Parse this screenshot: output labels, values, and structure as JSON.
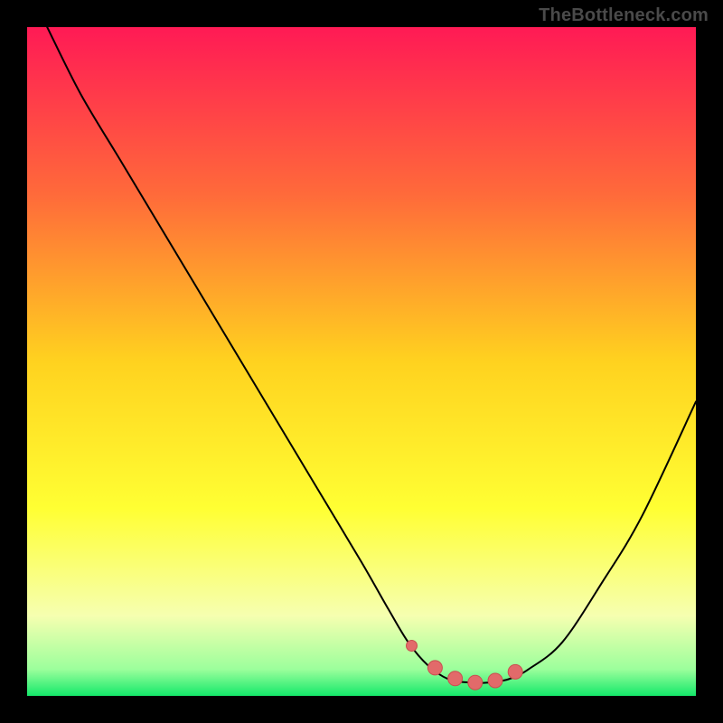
{
  "watermark": "TheBottleneck.com",
  "colors": {
    "page_bg": "#000000",
    "gradient_stops": [
      {
        "offset": "0%",
        "color": "#ff1a55"
      },
      {
        "offset": "25%",
        "color": "#ff6a3a"
      },
      {
        "offset": "50%",
        "color": "#ffd21f"
      },
      {
        "offset": "72%",
        "color": "#ffff33"
      },
      {
        "offset": "88%",
        "color": "#f6ffb0"
      },
      {
        "offset": "96%",
        "color": "#9cff9c"
      },
      {
        "offset": "100%",
        "color": "#14e86a"
      }
    ],
    "curve_stroke": "#000000",
    "marker_fill": "#e26a6a",
    "marker_stroke": "#c94f4f"
  },
  "chart_data": {
    "type": "line",
    "title": "",
    "xlabel": "",
    "ylabel": "",
    "xlim": [
      0,
      100
    ],
    "ylim": [
      0,
      100
    ],
    "x": [
      3,
      8,
      14,
      20,
      26,
      32,
      38,
      44,
      50,
      54,
      57,
      60,
      63,
      66,
      69,
      72,
      75,
      80,
      86,
      92,
      100
    ],
    "values": [
      100,
      90,
      80,
      70,
      60,
      50,
      40,
      30,
      20,
      13,
      8,
      4.5,
      2.5,
      2,
      2,
      2.5,
      4,
      8,
      17,
      27,
      44
    ],
    "markers": {
      "type": "scatter",
      "x": [
        57.5,
        61,
        64,
        67,
        70,
        73
      ],
      "values": [
        7.5,
        4.2,
        2.6,
        2.0,
        2.3,
        3.6
      ]
    }
  }
}
